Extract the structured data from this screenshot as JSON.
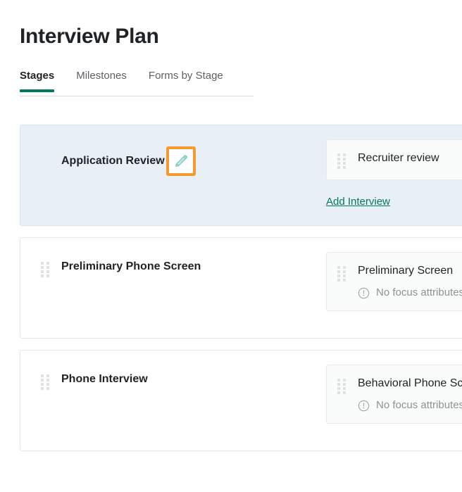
{
  "header": {
    "title": "Interview Plan"
  },
  "tabs": [
    {
      "label": "Stages",
      "active": true
    },
    {
      "label": "Milestones",
      "active": false
    },
    {
      "label": "Forms by Stage",
      "active": false
    }
  ],
  "colors": {
    "accent_green": "#00795c",
    "annotation_orange": "#f59a30",
    "selected_stage_bg": "#e9eff7",
    "card_bg": "#fafbfb",
    "pencil_teal": "#b7e4dd",
    "muted_text": "#8d9297",
    "title_text": "#1f2326"
  },
  "stages": [
    {
      "name": "Application Review",
      "selected": true,
      "has_drag_handle": false,
      "has_edit_icon": true,
      "edit_icon_name": "pencil-icon",
      "interviews": [
        {
          "title": "Recruiter review",
          "warning": null
        }
      ],
      "add_interview_label": "Add Interview"
    },
    {
      "name": "Preliminary Phone Screen",
      "selected": false,
      "has_drag_handle": true,
      "has_edit_icon": false,
      "interviews": [
        {
          "title": "Preliminary Screen",
          "warning": "No focus attributes"
        }
      ],
      "add_interview_label": null
    },
    {
      "name": "Phone Interview",
      "selected": false,
      "has_drag_handle": true,
      "has_edit_icon": false,
      "interviews": [
        {
          "title": "Behavioral Phone Screen",
          "warning": "No focus attributes"
        }
      ],
      "add_interview_label": null
    }
  ]
}
